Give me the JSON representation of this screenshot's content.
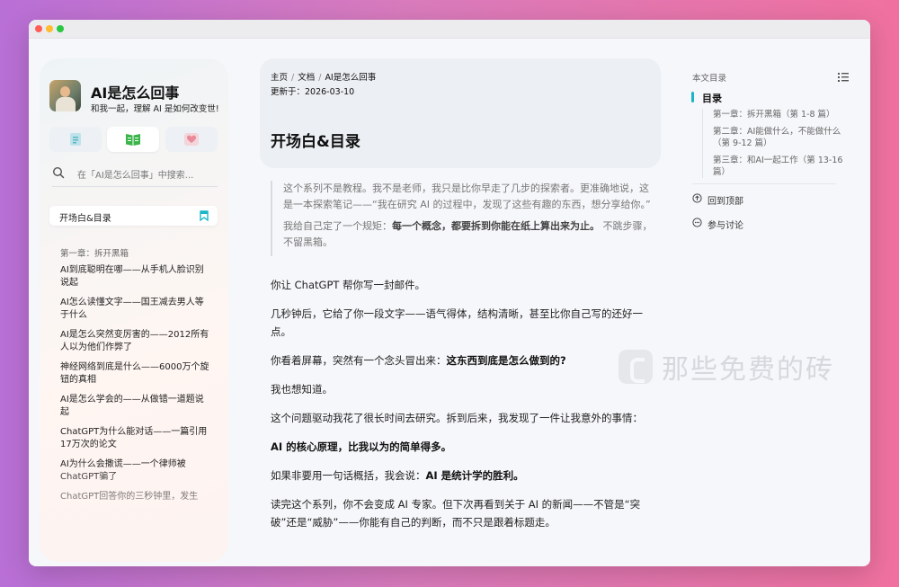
{
  "sidebar": {
    "title": "AI是怎么回事",
    "subtitle": "和我一起，理解 AI 是如何改变世!",
    "search_placeholder": "在「AI是怎么回事」中搜索...",
    "current_page": "开场白&目录",
    "section_label": "第一章：拆开黑箱",
    "items": [
      "AI到底聪明在哪——从手机人脸识别说起",
      "AI怎么读懂文字——国王减去男人等于什么",
      "AI是怎么突然变厉害的——2012所有人以为他们作弊了",
      "神经网络到底是什么——6000万个旋钮的真相",
      "AI是怎么学会的——从做错一道题说起",
      "ChatGPT为什么能对话——一篇引用17万次的论文",
      "AI为什么会撒谎——一个律师被ChatGPT骗了",
      "ChatGPT回答你的三秒钟里，发生"
    ]
  },
  "main": {
    "breadcrumb": [
      "主页",
      "文档",
      "AI是怎么回事"
    ],
    "breadcrumb_sep": "/",
    "updated": "更新于：2026-03-10",
    "title": "开场白&目录",
    "quote_p1": "这个系列不是教程。我不是老师，我只是比你早走了几步的探索者。更准确地说，这是一本探索笔记——“我在研究 AI 的过程中，发现了这些有趣的东西，想分享给你。”",
    "quote_p2_a": "我给自己定了一个规矩：",
    "quote_p2_b": "每一个概念，都要拆到你能在纸上算出来为止。",
    "quote_p2_c": " 不跳步骤，不留黑箱。",
    "p1": "你让 ChatGPT 帮你写一封邮件。",
    "p2": "几秒钟后，它给了你一段文字——语气得体，结构清晰，甚至比你自己写的还好一点。",
    "p3_a": "你看着屏幕，突然有一个念头冒出来：",
    "p3_b": "这东西到底是怎么做到的?",
    "p4": "我也想知道。",
    "p5": "这个问题驱动我花了很长时间去研究。拆到后来，我发现了一件让我意外的事情：",
    "p6": "AI 的核心原理，比我以为的简单得多。",
    "p7_a": "如果非要用一句话概括，我会说：",
    "p7_b": "AI 是统计学的胜利。",
    "p8": "读完这个系列，你不会变成 AI 专家。但下次再看到关于 AI 的新闻——不管是“突破”还是“威胁”——你能有自己的判断，而不只是跟着标题走。"
  },
  "toc": {
    "heading": "本文目录",
    "root": "目录",
    "items": [
      "第一章：拆开黑箱（第 1-8 篇）",
      "第二章：AI能做什么，不能做什么（第 9-12 篇）",
      "第三章：和AI一起工作（第 13-16 篇）"
    ],
    "back_to_top": "回到顶部",
    "discuss": "参与讨论"
  },
  "watermark": "那些免费的砖",
  "colors": {
    "accent": "#19b6c7",
    "book_green": "#3bb54a"
  }
}
